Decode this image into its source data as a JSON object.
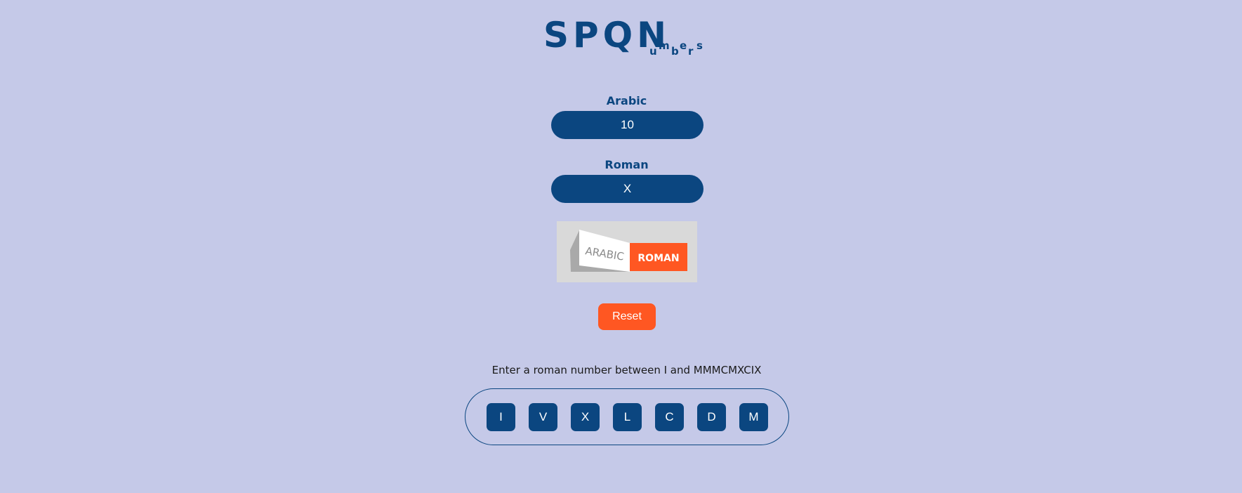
{
  "logo": {
    "main": "SPQN",
    "sub_letters": [
      "u",
      "m",
      "b",
      "e",
      "r",
      "s"
    ]
  },
  "arabic": {
    "label": "Arabic",
    "value": "10"
  },
  "roman": {
    "label": "Roman",
    "value": "X"
  },
  "mode_switch": {
    "left_label": "ARABIC",
    "right_label": "ROMAN",
    "active_color": "#ff5722"
  },
  "reset_label": "Reset",
  "instruction": "Enter a roman number between I and MMMCMXCIX",
  "keypad": {
    "keys": [
      "I",
      "V",
      "X",
      "L",
      "C",
      "D",
      "M"
    ]
  },
  "colors": {
    "background": "#c5c9e8",
    "primary": "#0b4680",
    "accent": "#ff5722",
    "panel": "#d9d9d9"
  }
}
